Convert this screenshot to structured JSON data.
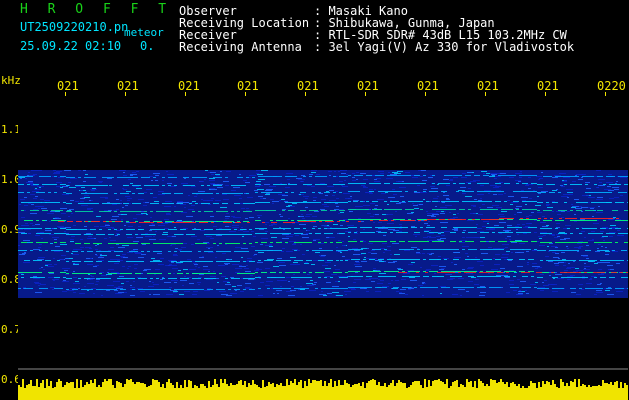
{
  "header": {
    "program": "H R O F F T",
    "filename": "UT2509220210.pn",
    "type_label": "meteor",
    "datetime": "25.09.22 02:10",
    "count": "0.",
    "fields": [
      {
        "label": "Observer",
        "value": ": Masaki Kano"
      },
      {
        "label": "Receiving Location",
        "value": ": Shibukawa, Gunma, Japan"
      },
      {
        "label": "Receiver",
        "value": ": RTL-SDR SDR# 43dB L15 103.2MHz CW"
      },
      {
        "label": "Receiving Antenna",
        "value": ": 3el Yagi(V) Az 330 for Vladivostok"
      }
    ]
  },
  "time_axis": {
    "ticks": [
      "021",
      "021",
      "021",
      "021",
      "021",
      "021",
      "021",
      "021",
      "021",
      "0220"
    ]
  },
  "freq_axis": {
    "unit": "kHz",
    "ticks": [
      "1.1",
      "1.0",
      "0.9",
      "0.8",
      "0.7",
      "0.6"
    ]
  },
  "colors": {
    "background": "#000000",
    "noise": "#0a23c8",
    "signal": "#00c8ff",
    "strong": "#ff2020",
    "level_bar": "#f0e400",
    "text_header": "#ffffff",
    "text_program": "#19d219",
    "text_file": "#00e5ff",
    "axis_text": "#f2e600"
  }
}
